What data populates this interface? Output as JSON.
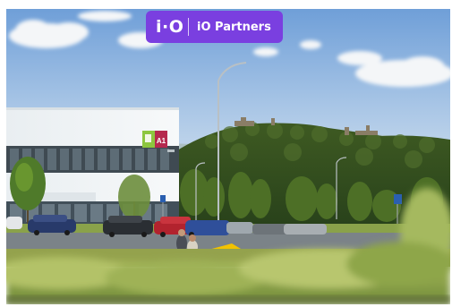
{
  "badge": {
    "logo_text": "i·O",
    "partner_name": "iO Partners",
    "background_color": "#7a3fe0"
  },
  "photo": {
    "building_sign_text": "A1",
    "sign_colors": [
      "#8dc63f",
      "#b5294e"
    ]
  }
}
